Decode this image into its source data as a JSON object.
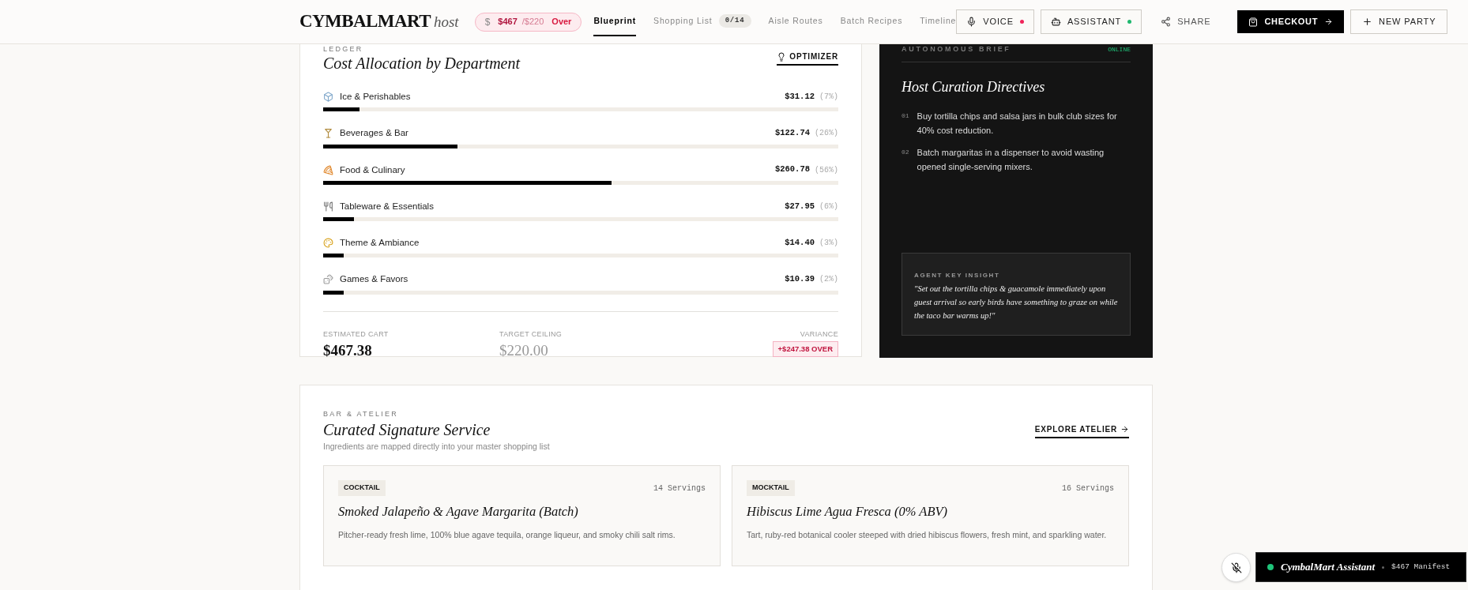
{
  "header": {
    "logo": "CYMBALMART",
    "logo_suffix": "host",
    "budget": {
      "symbol": "$",
      "spent": "$467",
      "ceiling": "/$220",
      "status": "Over"
    },
    "tabs": [
      {
        "label": "Blueprint",
        "selected": true
      },
      {
        "label": "Shopping List",
        "badge": "0/14",
        "selected": false
      },
      {
        "label": "Aisle Routes",
        "selected": false
      },
      {
        "label": "Batch Recipes",
        "selected": false
      },
      {
        "label": "Timeline",
        "selected": false
      }
    ],
    "voice": {
      "label": "VOICE",
      "color": "#f0245a"
    },
    "assistant": {
      "label": "ASSISTANT",
      "color": "#1fb86e"
    },
    "share": "SHARE",
    "checkout": "CHECKOUT",
    "new_party": "NEW PARTY"
  },
  "ledger": {
    "eyebrow": "LEDGER",
    "title": "Cost Allocation by Department",
    "action": "OPTIMIZER",
    "departments": [
      {
        "name": "Ice & Perishables",
        "amount": "$31.12",
        "share": "(7%)",
        "level": 0.07
      },
      {
        "name": "Beverages & Bar",
        "amount": "$122.74",
        "share": "(26%)",
        "level": 0.26
      },
      {
        "name": "Food & Culinary",
        "amount": "$260.78",
        "share": "(56%)",
        "level": 0.56
      },
      {
        "name": "Tableware & Essentials",
        "amount": "$27.95",
        "share": "(6%)",
        "level": 0.06
      },
      {
        "name": "Theme & Ambiance",
        "amount": "$14.40",
        "share": "(3%)",
        "level": 0.04
      },
      {
        "name": "Games & Favors",
        "amount": "$10.39",
        "share": "(2%)",
        "level": 0.04
      }
    ],
    "estimated_label": "ESTIMATED CART",
    "estimated": "$467.38",
    "target_label": "TARGET CEILING",
    "target": "$220.00",
    "variance_label": "VARIANCE",
    "variance": "+$247.38 OVER"
  },
  "brief": {
    "eyebrow": "AUTONOMOUS BRIEF",
    "status": "ONLINE",
    "title": "Host Curation Directives",
    "directives": [
      {
        "number": "01",
        "text": "Buy tortilla chips and salsa jars in bulk club sizes for 40% cost reduction."
      },
      {
        "number": "02",
        "text": "Batch margaritas in a dispenser to avoid wasting opened single-serving mixers."
      }
    ],
    "insight_label": "AGENT KEY INSIGHT",
    "insight": "\"Set out the tortilla chips & guacamole immediately upon guest arrival so early birds have something to graze on while the taco bar warms up!\""
  },
  "atelier": {
    "eyebrow": "BAR & ATELIER",
    "title": "Curated Signature Service",
    "subtitle": "Ingredients are mapped directly into your master shopping list",
    "action": "EXPLORE ATELIER",
    "drinks": [
      {
        "tag": "COCKTAIL",
        "servings": "14 Servings",
        "name": "Smoked Jalapeño & Agave Margarita (Batch)",
        "description": "Pitcher-ready fresh lime, 100% blue agave tequila, orange liqueur, and smoky chili salt rims."
      },
      {
        "tag": "MOCKTAIL",
        "servings": "16 Servings",
        "name": "Hibiscus Lime Agua Fresca (0% ABV)",
        "description": "Tart, ruby-red botanical cooler steeped with dried hibiscus flowers, fresh mint, and sparkling water."
      }
    ]
  },
  "assistant_bar": {
    "title": "CymbalMart Assistant",
    "manifest": "$467 Manifest",
    "color": "#1fc47a"
  }
}
